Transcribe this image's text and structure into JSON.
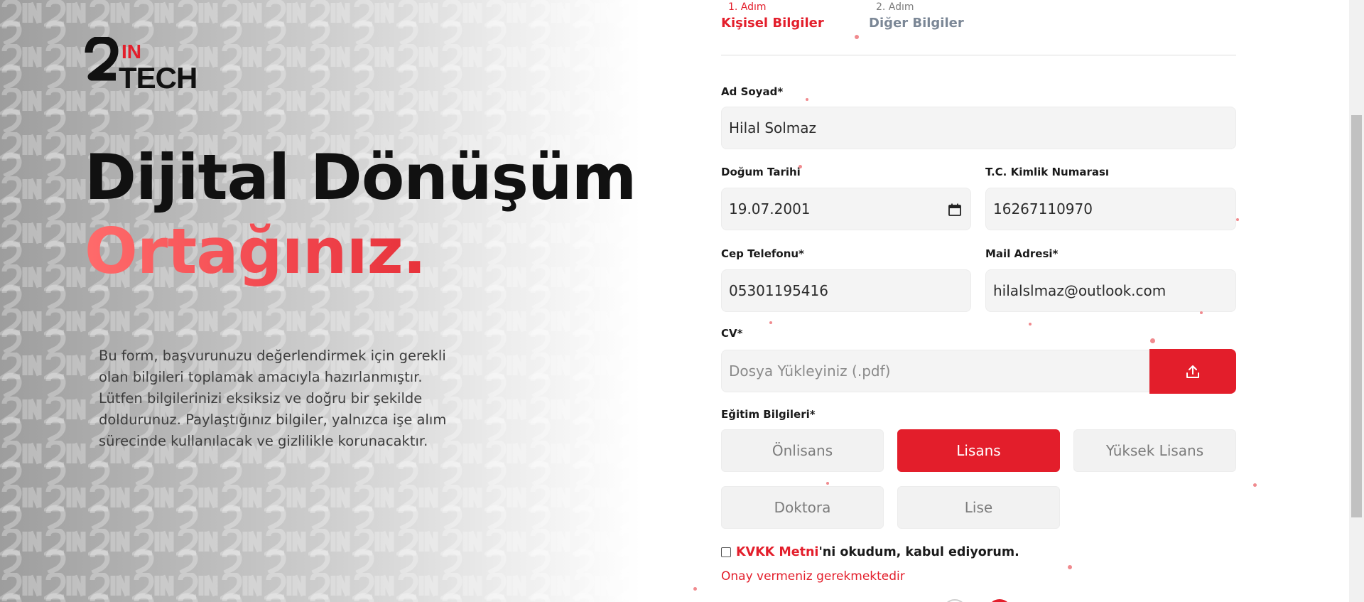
{
  "brand": {
    "logo_top": "IN",
    "logo_bottom": "TECH"
  },
  "hero": {
    "headline_line1": "Dijital Dönüşüm",
    "headline_line2": "Ortağınız.",
    "description": "Bu form, başvurunuzu değerlendirmek için gerekli olan bilgileri toplamak amacıyla hazırlanmıştır. Lütfen bilgilerinizi eksiksiz ve doğru bir şekilde doldurunuz. Paylaştığınız bilgiler, yalnızca işe alım sürecinde kullanılacak ve gizlilikle korunacaktır."
  },
  "steps": [
    {
      "number": "1. Adım",
      "title": "Kişisel Bilgiler",
      "active": true
    },
    {
      "number": "2. Adım",
      "title": "Diğer Bilgiler",
      "active": false
    }
  ],
  "form": {
    "name": {
      "label": "Ad Soyad*",
      "value": "Hilal Solmaz"
    },
    "birthdate": {
      "label": "Doğum Tarihi",
      "value": "19.07.2001"
    },
    "tc": {
      "label": "T.C. Kimlik Numarası",
      "value": "16267110970"
    },
    "phone": {
      "label": "Cep Telefonu*",
      "value": "05301195416"
    },
    "email": {
      "label": "Mail Adresi*",
      "value": "hilalslmaz@outlook.com"
    },
    "cv": {
      "label": "CV*",
      "placeholder": "Dosya Yükleyiniz (.pdf)",
      "upload_icon": "upload-icon"
    },
    "education": {
      "label": "Eğitim Bilgileri*",
      "options": [
        "Önlisans",
        "Lisans",
        "Yüksek Lisans",
        "Doktora",
        "Lise"
      ],
      "selected": "Lisans"
    },
    "kvkk": {
      "link_text": "KVKK Metni",
      "rest_text": "'ni okudum, kabul ediyorum.",
      "checked": false
    },
    "error": "Onay vermeniz gerekmektedir"
  },
  "colors": {
    "accent": "#e31e2b",
    "field_bg": "#f4f4f4",
    "text_dark": "#111111"
  }
}
